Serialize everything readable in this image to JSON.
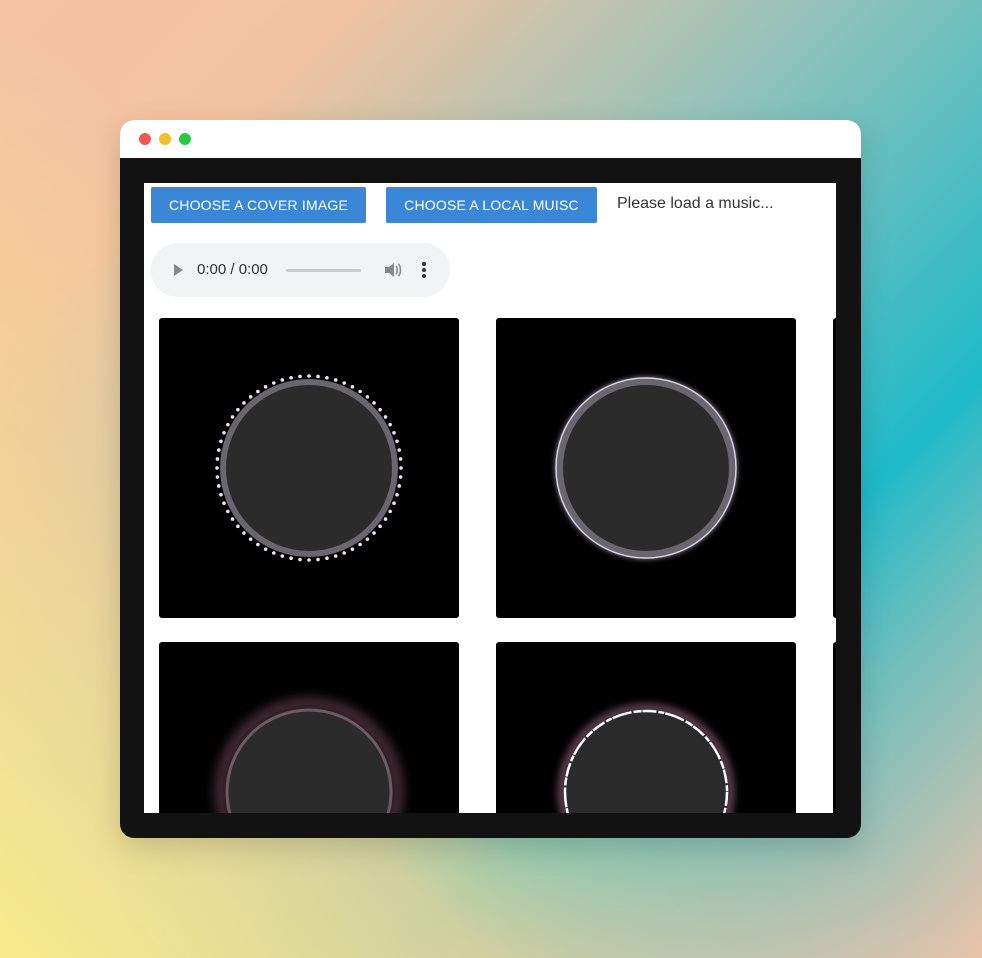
{
  "toolbar": {
    "cover_label": "CHOOSE A COVER IMAGE",
    "music_label": "CHOOSE A LOCAL MUISC",
    "status_text": "Please load a music..."
  },
  "audio": {
    "time": "0:00 / 0:00",
    "progress": 0
  },
  "icons": {
    "play": "play-icon",
    "volume": "volume-icon",
    "more": "more-vert-icon"
  },
  "colors": {
    "button": "#3a87d8",
    "card_bg": "#000000",
    "disc": "#2b2b2b"
  },
  "visualizers": [
    {
      "style": "dotted-ring"
    },
    {
      "style": "glow-ring"
    },
    {
      "style": "pink-halo"
    },
    {
      "style": "spiky-ring"
    }
  ]
}
